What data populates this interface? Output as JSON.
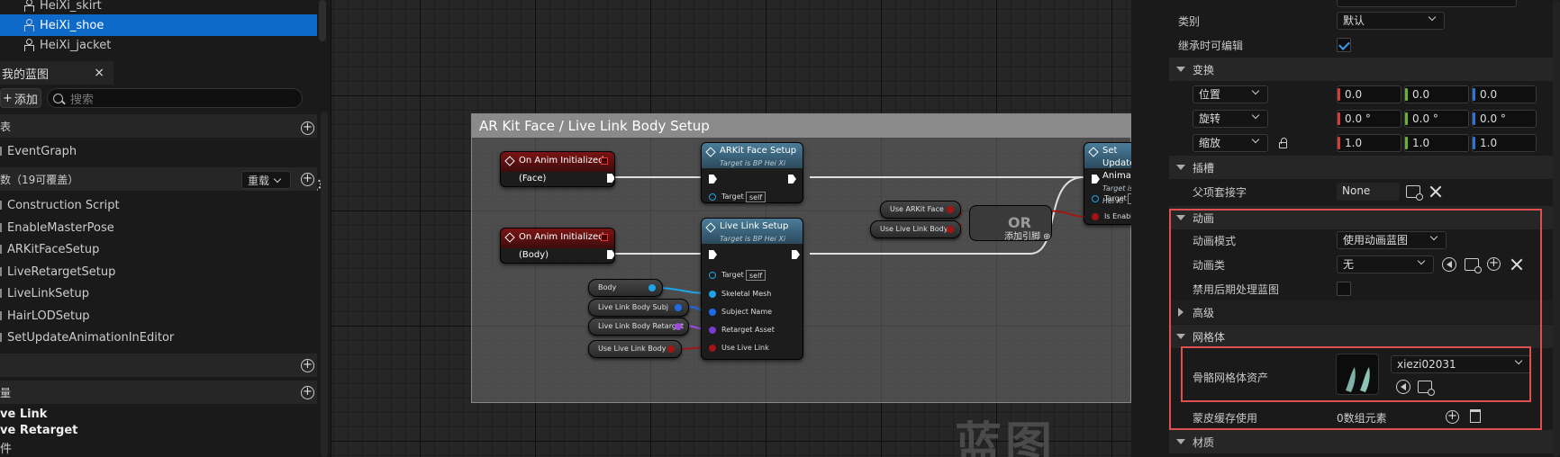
{
  "assets": [
    {
      "label": "HeiXi_skirt"
    },
    {
      "label": "HeiXi_shoe"
    },
    {
      "label": "HeiXi_jacket"
    }
  ],
  "my_blueprint": {
    "tab_label": "我的蓝图",
    "close": "×",
    "add_label": "添加",
    "search_placeholder": "搜索",
    "graphs_header": "表",
    "event_graph": "EventGraph",
    "functions_header": "数（19可覆盖）",
    "override_label": "重载",
    "functions": [
      "Construction Script",
      "EnableMasterPose",
      "ARKitFaceSetup",
      "LiveRetargetSetup",
      "LiveLinkSetup",
      "HairLODSetup",
      "SetUpdateAnimationInEditor"
    ],
    "variables_header": "量",
    "variables": [
      "ve Link",
      "ve Retarget"
    ],
    "variables_extra": "件"
  },
  "graph": {
    "comment_title": "AR Kit Face / Live Link Body Setup",
    "ev_face": "On Anim Initialized (Face)",
    "ev_body": "On Anim Initialized (Body)",
    "arkit_title": "ARKit Face Setup",
    "target_sub": "Target is BP Hei Xi",
    "target_label": "Target",
    "self_label": "self",
    "livelink_title": "Live Link Setup",
    "pin_skeletal": "Skeletal Mesh",
    "pin_subject": "Subject Name",
    "pin_retarget": "Retarget Asset",
    "pin_uselive": "Use Live Link",
    "var_body": "Body",
    "var_subj": "Live Link Body Subj",
    "var_retarget": "Live Link Body Retarget",
    "var_uselive": "Use Live Link Body",
    "var_arkitface": "Use ARKit Face",
    "var_uselivebody2": "Use Live Link Body",
    "or_label": "OR",
    "or_add": "添加引脚 ⊕",
    "setupdate_title": "Set Update Anima",
    "pin_isenabled": "Is Enabled",
    "watermark": "蓝图"
  },
  "details": {
    "category_label": "类别",
    "category_value": "默认",
    "inherit_label": "继承时可编辑",
    "transform_header": "变换",
    "location_label": "位置",
    "location": [
      "0.0",
      "0.0",
      "0.0"
    ],
    "rotation_label": "旋转",
    "rotation": [
      "0.0 °",
      "0.0 °",
      "0.0 °"
    ],
    "scale_label": "缩放",
    "scale": [
      "1.0",
      "1.0",
      "1.0"
    ],
    "sockets_header": "插槽",
    "parent_socket_label": "父项套接字",
    "parent_socket_value": "None",
    "animation_header": "动画",
    "anim_mode_label": "动画模式",
    "anim_mode_value": "使用动画蓝图",
    "anim_class_label": "动画类",
    "anim_class_value": "无",
    "disable_post_label": "禁用后期处理蓝图",
    "advanced_header": "高级",
    "mesh_header": "网格体",
    "skel_mesh_label": "骨骼网格体资产",
    "skel_mesh_value": "xiezi02031",
    "skin_cache_label": "蒙皮缓存使用",
    "skin_cache_value": "0数组元素",
    "materials_header": "材质"
  },
  "colors": {
    "selection": "#0e6ac9",
    "highlight_box": "#e04f4f",
    "exec": "#ffffff",
    "bool_pin": "#a31515",
    "name_pin": "#c98ce0",
    "object_pin": "#1ea3e6",
    "struct_pin": "#1e6be6"
  }
}
